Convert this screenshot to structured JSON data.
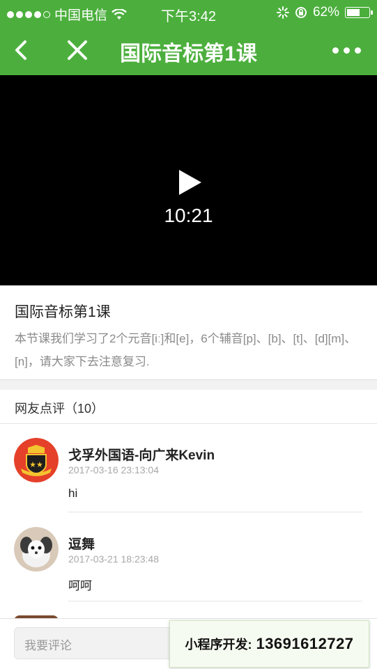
{
  "status_bar": {
    "carrier": "中国电信",
    "time": "下午3:42",
    "battery": "62%",
    "battery_level": 0.62
  },
  "nav": {
    "title": "国际音标第1课",
    "icons": [
      "back-arrow-icon",
      "close-icon",
      "more-icon"
    ]
  },
  "video": {
    "duration": "10:21",
    "icon": "play-icon"
  },
  "lesson": {
    "title": "国际音标第1课",
    "description": "本节课我们学习了2个元音[iː]和[e]，6个辅音[p]、[b]、[t]、[d][m]、[n]，请大家下去注意复习."
  },
  "comments": {
    "header": "网友点评（10）",
    "items": [
      {
        "name": "戈孚外国语-向广来Kevin",
        "date": "2017-03-16 23:13:04",
        "text": "hi"
      },
      {
        "name": "逗舞",
        "date": "2017-03-21 18:23:48",
        "text": "呵呵"
      }
    ]
  },
  "bottom": {
    "comment_placeholder": "我要评论",
    "promo_label": "小程序开发:",
    "promo_number": "13691612727"
  },
  "colors": {
    "accent": "#4caf3d",
    "video_bg": "#000000"
  }
}
